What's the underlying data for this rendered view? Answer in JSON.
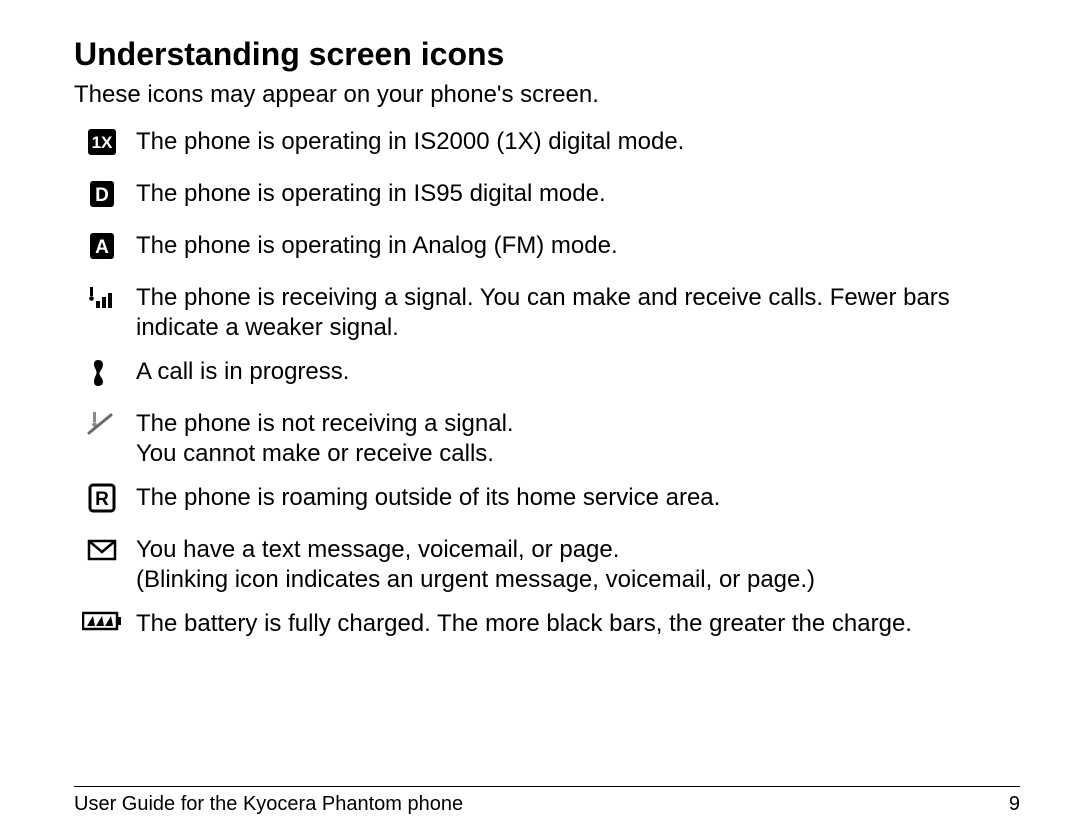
{
  "heading": "Understanding screen icons",
  "intro": "These icons may appear on your phone's screen.",
  "items": [
    {
      "icon": "1x-icon",
      "text": "The phone is operating in IS2000 (1X) digital mode."
    },
    {
      "icon": "d-icon",
      "text": "The phone is operating in IS95 digital mode."
    },
    {
      "icon": "a-icon",
      "text": "The phone is operating in Analog (FM) mode."
    },
    {
      "icon": "signal-icon",
      "text": "The phone is receiving a signal. You can make and receive calls. Fewer bars indicate a weaker signal."
    },
    {
      "icon": "call-icon",
      "text": "A call is in progress."
    },
    {
      "icon": "no-signal-icon",
      "text": "The phone is not receiving a signal.\nYou cannot make or receive calls."
    },
    {
      "icon": "roaming-icon",
      "text": "The phone is roaming outside of its home service area."
    },
    {
      "icon": "message-icon",
      "text": "You have a text message, voicemail, or page.\n(Blinking icon indicates an urgent message, voicemail, or page.)"
    },
    {
      "icon": "battery-icon",
      "text": "The battery is fully charged. The more black bars, the greater the charge."
    }
  ],
  "footer_left": "User Guide for the Kyocera Phantom phone",
  "footer_right": "9"
}
